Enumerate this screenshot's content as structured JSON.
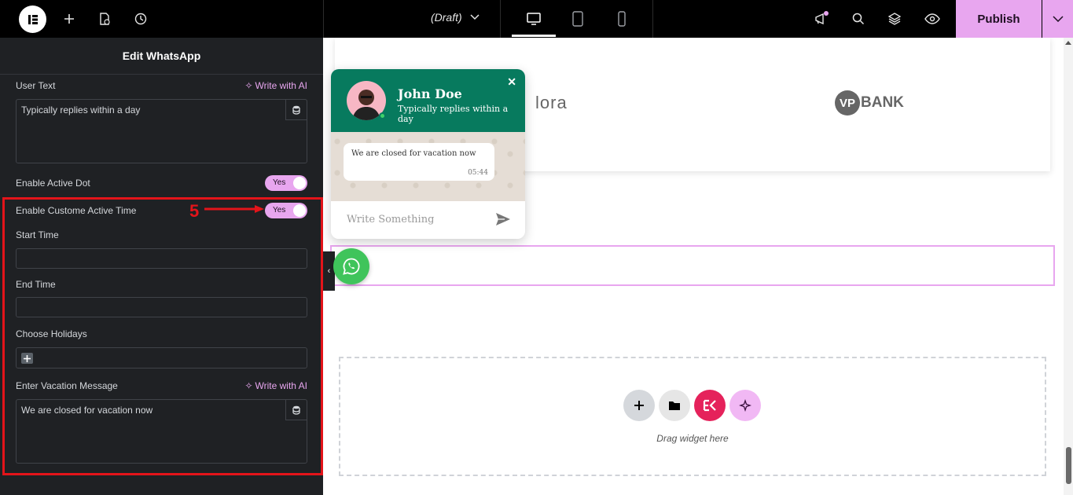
{
  "topbar": {
    "draft_label": "(Draft)",
    "publish_label": "Publish",
    "accent": "#e8a6ef"
  },
  "panel": {
    "title": "Edit WhatsApp",
    "user_text_label": "User Text",
    "write_ai_label": "Write with AI",
    "user_text_value": "Typically replies within a day",
    "enable_active_dot_label": "Enable Active Dot",
    "toggle_yes": "Yes",
    "enable_custom_time_label": "Enable Custome Active Time",
    "start_time_label": "Start Time",
    "end_time_label": "End Time",
    "holidays_label": "Choose Holidays",
    "vacation_label": "Enter Vacation Message",
    "vacation_value": "We are closed for vacation now",
    "step_number": "5"
  },
  "canvas": {
    "logo_partial": "lora",
    "logo_vp": "VP",
    "logo_bank": "BANK",
    "drag_text": "Drag widget here"
  },
  "whatsapp": {
    "name": "John Doe",
    "subtitle": "Typically replies within a day",
    "message": "We are closed for vacation now",
    "time": "05:44",
    "placeholder": "Write Something",
    "header_color": "#077a5e",
    "fab_color": "#3fc45b"
  }
}
